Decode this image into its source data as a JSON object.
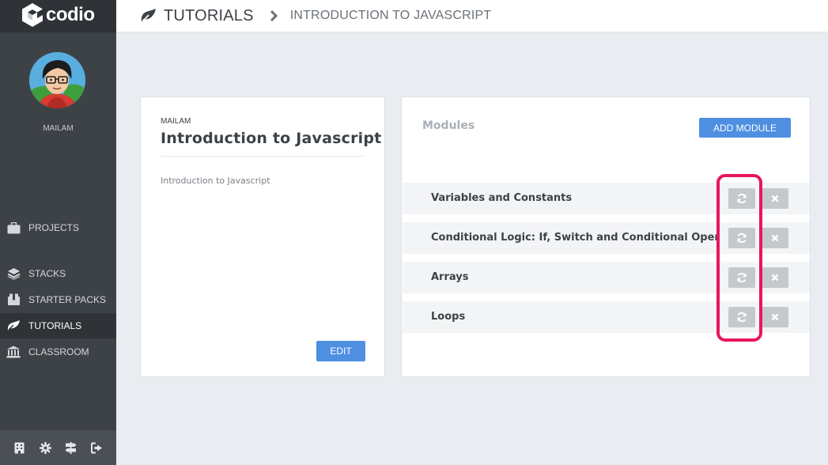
{
  "brand": {
    "name": "codio"
  },
  "user": {
    "name": "MAILAM"
  },
  "sidebar": {
    "items": [
      {
        "label": "PROJECTS",
        "icon": "briefcase-icon"
      },
      {
        "label": "STACKS",
        "icon": "layers-icon"
      },
      {
        "label": "STARTER PACKS",
        "icon": "box-icon"
      },
      {
        "label": "TUTORIALS",
        "icon": "tutorial-icon",
        "active": true
      },
      {
        "label": "CLASSROOM",
        "icon": "institution-icon"
      }
    ],
    "bottom_icons": [
      "building-icon",
      "gear-icon",
      "signpost-icon",
      "sign-out-icon"
    ]
  },
  "breadcrumb": {
    "section": "TUTORIALS",
    "page": "INTRODUCTION TO JAVASCRIPT"
  },
  "tutorial": {
    "owner": "MAILAM",
    "title": "Introduction to Javascript",
    "description": "Introduction to Javascript",
    "edit_label": "EDIT"
  },
  "modules": {
    "heading": "Modules",
    "add_label": "ADD MODULE",
    "items": [
      {
        "name": "Variables and Constants"
      },
      {
        "name": "Conditional Logic: If, Switch and Conditional Operator"
      },
      {
        "name": "Arrays"
      },
      {
        "name": "Loops"
      }
    ]
  },
  "colors": {
    "sidebar": "#3d4247",
    "accent": "#4f8fe2",
    "highlight": "#e8165f"
  }
}
